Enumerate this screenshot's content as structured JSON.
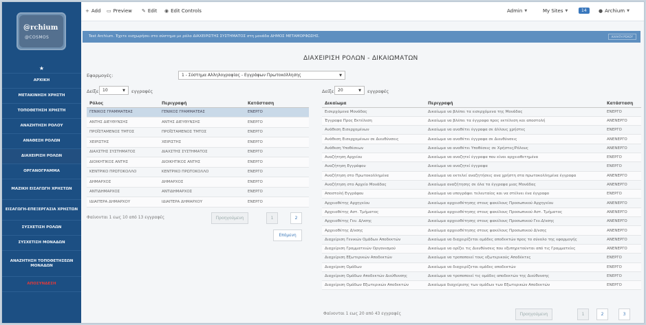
{
  "sidebar": {
    "logo": {
      "brand": "@rchium",
      "sub": "@COSMOS"
    },
    "items": [
      {
        "label": "ΑΡΧΙΚΗ"
      },
      {
        "label": "ΜΕΤΑΚΙΝΗΣΗ ΧΡΗΣΤΗ"
      },
      {
        "label": "ΤΟΠΟΘΕΤΗΣΗ ΧΡΗΣΤΗ"
      },
      {
        "label": "ΑΝΑΖΗΤΗΣΗ ΡΟΛΟΥ"
      },
      {
        "label": "ΑΝΑΘΕΣΗ ΡΟΛΩΝ"
      },
      {
        "label": "ΔΙΑΧΕΙΡΙΣΗ ΡΟΛΩΝ"
      },
      {
        "label": "ΟΡΓΑΝΟΓΡΑΜΜΑ"
      },
      {
        "label": "ΜΑΖΙΚΗ ΕΙΣΑΓΩΓΗ ΧΡΗΣΤΩΝ"
      },
      {
        "label": "ΕΙΣΑΓΩΓΗ-ΕΠΕΞΕΡΓΑΣΙΑ ΧΡΗΣΤΩΝ"
      },
      {
        "label": "ΣΥΣΧΕΤΙΣΗ ΡΟΛΩΝ"
      },
      {
        "label": "ΣΥΣΧΕΤΙΣΗ ΜΟΝΑΔΩΝ"
      },
      {
        "label": "ΑΝΑΖΗΤΗΣΗ ΤΟΠΟΘΕΤΗΣΕΩΝ ΜΟΝΑΔΩΝ"
      },
      {
        "label": "ΑΠΟΣΥΝΔΕΣΗ"
      }
    ]
  },
  "topbar": {
    "add": "Add",
    "preview": "Preview",
    "edit": "Edit",
    "edit_controls": "Edit Controls",
    "admin": "Admin",
    "my_sites": "My Sites",
    "badge": "14",
    "user": "Archium"
  },
  "alert": {
    "text": "Test Archium. Έχετε εισχωρήσει στο σύστημα με ρόλο ΔΙΑΧΕΙΡΙΣΤΗΣ ΣΥΣΤΗΜΑΤΟΣ στη μονάδα ΔΗΜΟΣ ΜΕΤΑΜΟΡΦΩΣΗΣ.",
    "role_button": "ΑΛΛΑΓΗ ΡΟΛΟΥ"
  },
  "page_title": "ΔΙΑΧΕΙΡΙΣΗ ΡΟΛΩΝ - ΔΙΚΑΙΩΜΑΤΩΝ",
  "app_label": "Εφαρμογές:",
  "app_select": "1 - Σύστημα Αλληλογραφίας - Εγγράφων Πρωτοκόλλησης",
  "roles": {
    "show_prefix": "Δείξε",
    "show_value": "10",
    "show_suffix": "εγγραφές",
    "headers": [
      "Ρόλος",
      "Περιγραφή",
      "Κατάσταση"
    ],
    "rows": [
      [
        "ΓΕΝΙΚΟΣ ΓΡΑΜΜΑΤΕΑΣ",
        "ΓΕΝΙΚΟΣ ΓΡΑΜΜΑΤΕΑΣ",
        "ΕΝΕΡΓΟ"
      ],
      [
        "ΑΝΤΗΣ ΔΙΕΥΘΥΝΣΗΣ",
        "ΑΝΤΗΣ ΔΙΕΥΘΥΝΣΗΣ",
        "ΕΝΕΡΓΟ"
      ],
      [
        "ΠΡΟΪΣΤΑΜΕΝΟΣ ΤΜΤΟΣ",
        "ΠΡΟΪΣΤΑΜΕΝΟΣ ΤΜΤΟΣ",
        "ΕΝΕΡΓΟ"
      ],
      [
        "ΧΕΙΡΙΣΤΗΣ",
        "ΧΕΙΡΙΣΤΗΣ",
        "ΕΝΕΡΓΟ"
      ],
      [
        "ΔΙΑΧΣΤΗΣ ΣΥΣΤΗΜΑΤΟΣ",
        "ΔΙΑΧΣΤΗΣ ΣΥΣΤΗΜΑΤΟΣ",
        "ΕΝΕΡΓΟ"
      ],
      [
        "ΔΙΟΙΚΗΤΙΚΟΣ ΑΝΤΗΣ",
        "ΔΙΟΙΚΗΤΙΚΟΣ ΑΝΤΗΣ",
        "ΕΝΕΡΓΟ"
      ],
      [
        "ΚΕΝΤΡΙΚΟ ΠΡΩΤΟΚΟΛΛΟ",
        "ΚΕΝΤΡΙΚΟ ΠΡΩΤΟΚΟΛΛΟ",
        "ΕΝΕΡΓΟ"
      ],
      [
        "ΔΗΜΑΡΧΟΣ",
        "ΔΗΜΑΡΧΟΣ",
        "ΕΝΕΡΓΟ"
      ],
      [
        "ΑΝΤΙΔΗΜΑΡΧΟΣ",
        "ΑΝΤΙΔΗΜΑΡΧΟΣ",
        "ΕΝΕΡΓΟ"
      ],
      [
        "ΙΔΙΑΙΤΕΡΑ ΔΗΜΑΡΧΟΥ",
        "ΙΔΙΑΙΤΕΡΑ ΔΗΜΑΡΧΟΥ",
        "ΕΝΕΡΓΟ"
      ]
    ],
    "info": "Φαίνονται 1 εως 10 από 13 εγγραφές",
    "prev": "Προηγούμενη",
    "pages": [
      "1",
      "2"
    ],
    "next": "Επόμενη"
  },
  "rights": {
    "show_prefix": "Δείξε",
    "show_value": "20",
    "show_suffix": "εγγραφές",
    "headers": [
      "Δικαίωμα",
      "Περιγραφή",
      "Κατάσταση"
    ],
    "rows": [
      [
        "Εισερχόμενα Μονάδας",
        "Δικαίωμα να βλέπει τα εισερχόμενα της Μονάδας",
        "ΕΝΕΡΓΟ"
      ],
      [
        "Έγγραφα Προς Εκτέλεση",
        "Δικαίωμα να βλέπει τα έγγραφα προς εκτέλεση και αποστολή",
        "ΑΝΕΝΕΡΓΟ"
      ],
      [
        "Ανάθεση Εισερχομένων",
        "Δικαίωμα να αναθέτει έγγραφα σε άλλους χρήστες",
        "ΕΝΕΡΓΟ"
      ],
      [
        "Ανάθεση Εισερχομένων σε Διευθύνσεις",
        "Δικαίωμα να αναθέτει έγγραφα σε Διευθύνσεις",
        "ΑΝΕΝΕΡΓΟ"
      ],
      [
        "Ανάθεση Υποθέσεων",
        "Δικαίωμα να αναθέτει Υποθέσεις σε Χρήστες/Ρόλους",
        "ΑΝΕΝΕΡΓΟ"
      ],
      [
        "Αναζήτηση Αρχείου",
        "Δικαίωμα να αναζητεί έγγραφα που είναι αρχειοθετημένα",
        "ΕΝΕΡΓΟ"
      ],
      [
        "Αναζήτηση Εγγράφου",
        "Δικαίωμα να αναζητεί έγγραφα",
        "ΕΝΕΡΓΟ"
      ],
      [
        "Αναζήτηση στο Πρωτοκολλημένα",
        "Δικαίωμα να εκτελεί αναζητήσεις ανα χρήστη στα πρωτοκολλημένα έγγραφα",
        "ΑΝΕΝΕΡΓΟ"
      ],
      [
        "Αναζήτηση στο Αρχείο Μονάδας",
        "Δικαίωμα αναζήτησης σε όλα τα έγγραφα μιας Μονάδας",
        "ΑΝΕΝΕΡΓΟ"
      ],
      [
        "Αποστολή Εγγράφου",
        "Δικαίωμα να υπογράφει τελευταίος και να στέλνει ένα έγγραφο",
        "ΕΝΕΡΓΟ"
      ],
      [
        "Αρχειοθέτης Αρχηγείου",
        "Δικαίωμα αρχειοθέτησης στους φακέλους Προσωπικού Αρχηγείου",
        "ΑΝΕΝΕΡΓΟ"
      ],
      [
        "Αρχειοθέτης Αστ. Τμήματος",
        "Δικαίωμα αρχειοθέτησης στους φακέλους Προσωπικού Αστ. Τμήματος",
        "ΑΝΕΝΕΡΓΟ"
      ],
      [
        "Αρχειοθέτης Γεν. Δ/νσης",
        "Δικαίωμα αρχειοθέτησης στους φακέλους Προσωπικού Γεν.Δ/νσης",
        "ΑΝΕΝΕΡΓΟ"
      ],
      [
        "Αρχειοθέτης Δ/νσης",
        "Δικαίωμα αρχειοθέτησης στους φακέλους Προσωπικού Δ/νσης",
        "ΑΝΕΝΕΡΓΟ"
      ],
      [
        "Διαχείριση Γενικών Ομάδων Αποδεκτών",
        "Δικαίωμα να διαχειρίζεται ομάδες αποδεκτών προς το σύνολο της εφαρμογής",
        "ΑΝΕΝΕΡΓΟ"
      ],
      [
        "Διαχείριση Γραμματειών Οργανισμού",
        "Δικαίωμα να ορίζει τις Διευθύνσεις που εξυπηρετούνται από τις Γραμματείες",
        "ΑΝΕΝΕΡΓΟ"
      ],
      [
        "Διαχείριση Εξωτερικών Αποδεκτών",
        "Δικαίωμα να τροποποιεί τους εξωτερικούς Αποδέκτες",
        "ΕΝΕΡΓΟ"
      ],
      [
        "Διαχείριση Ομάδων",
        "Δικαίωμα να διαχειρίζεται ομάδες αποδεκτών",
        "ΕΝΕΡΓΟ"
      ],
      [
        "Διαχείριση Ομάδων Αποδεκτών Διεύθυνσης",
        "Δικαίωμα να τροποποιεί τις ομάδες αποδεκτών της Διεύθυνσης",
        "ΕΝΕΡΓΟ"
      ],
      [
        "Διαχείριση Ομάδων Εξωτερικών Αποδεκτών",
        "Δικαίωμα διαχείρισης των ομάδων των Εξωτερικών Αποδεκτών",
        "ΕΝΕΡΓΟ"
      ]
    ],
    "info": "Φαίνονται 1 εως 20 από 43 εγγραφές",
    "prev": "Προηγούμενη",
    "pages": [
      "1",
      "2",
      "3"
    ]
  }
}
